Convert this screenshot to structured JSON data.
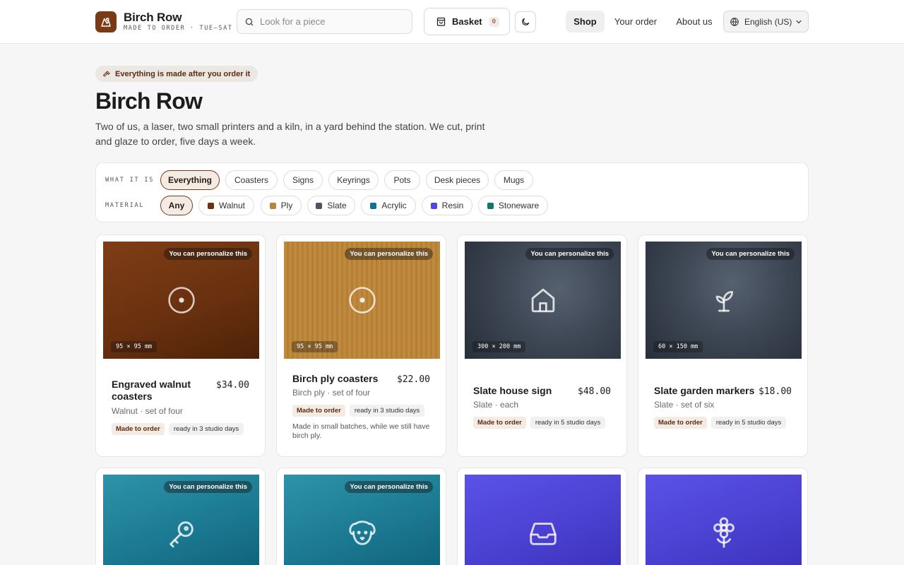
{
  "header": {
    "brand_name": "Birch Row",
    "brand_tagline": "MADE TO ORDER · TUE–SAT",
    "search_placeholder": "Look for a piece",
    "basket_label": "Basket",
    "basket_count": "0",
    "nav": [
      "Shop",
      "Your order",
      "About us"
    ],
    "language": "English (US)"
  },
  "hero": {
    "pill": "Everything is made after you order it",
    "title": "Birch Row",
    "description": "Two of us, a laser, two small printers and a kiln, in a yard behind the station. We cut, print and glaze to order, five days a week."
  },
  "filters": {
    "category_label": "WHAT IT IS",
    "categories": [
      "Everything",
      "Coasters",
      "Signs",
      "Keyrings",
      "Pots",
      "Desk pieces",
      "Mugs"
    ],
    "material_label": "MATERIAL",
    "materials": [
      {
        "label": "Any"
      },
      {
        "label": "Walnut",
        "color": "#6b3410"
      },
      {
        "label": "Ply",
        "color": "#b8843a"
      },
      {
        "label": "Slate",
        "color": "#4b5563"
      },
      {
        "label": "Acrylic",
        "color": "#0e7490"
      },
      {
        "label": "Resin",
        "color": "#4f46e5"
      },
      {
        "label": "Stoneware",
        "color": "#0f766e"
      }
    ]
  },
  "products": [
    {
      "name": "Engraved walnut coasters",
      "price": "$34.00",
      "sub": "Walnut · set of four",
      "badge": "You can personalize this",
      "size": "95 × 95 mm",
      "made": "Made to order",
      "ready": "ready in 3 studio days",
      "icon": "coaster-icon",
      "color_a": "#7a3a14",
      "color_b": "#4e2208"
    },
    {
      "name": "Birch ply coasters",
      "price": "$22.00",
      "sub": "Birch ply · set of four",
      "badge": "You can personalize this",
      "size": "95 × 95 mm",
      "made": "Made to order",
      "ready": "ready in 3 studio days",
      "note": "Made in small batches, while we still have birch ply.",
      "icon": "coaster-icon",
      "color_a": "#c08a3e",
      "color_b": "#9a6524"
    },
    {
      "name": "Slate house sign",
      "price": "$48.00",
      "sub": "Slate · each",
      "badge": "You can personalize this",
      "size": "300 × 200 mm",
      "made": "Made to order",
      "ready": "ready in 5 studio days",
      "icon": "house-icon",
      "color_a": "#4a5563",
      "color_b": "#2b3440"
    },
    {
      "name": "Slate garden markers",
      "price": "$18.00",
      "sub": "Slate · set of six",
      "badge": "You can personalize this",
      "size": "60 × 150 mm",
      "made": "Made to order",
      "ready": "ready in 5 studio days",
      "icon": "sprout-icon",
      "color_a": "#4a5563",
      "color_b": "#2b3440"
    },
    {
      "badge": "You can personalize this",
      "icon": "key-icon",
      "color_a": "#2b8ea6",
      "color_b": "#0d5f77"
    },
    {
      "badge": "You can personalize this",
      "icon": "dog-icon",
      "color_a": "#2b8ea6",
      "color_b": "#0d5f77"
    },
    {
      "icon": "inbox-tray-icon",
      "color_a": "#5148e0",
      "color_b": "#3a2fb8"
    },
    {
      "icon": "flower-icon",
      "color_a": "#5148e0",
      "color_b": "#3a2fb8"
    }
  ]
}
